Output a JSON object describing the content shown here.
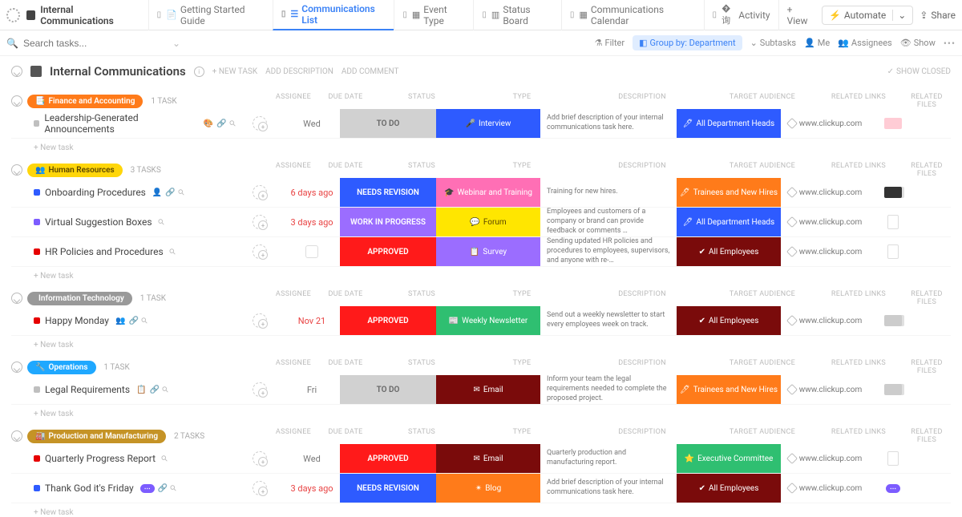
{
  "topbar": {
    "title": "Internal Communications",
    "tabs": [
      {
        "label": "Getting Started Guide",
        "icon": "📄"
      },
      {
        "label": "Communications List",
        "icon": "☰",
        "active": true
      },
      {
        "label": "Event Type",
        "icon": "▦"
      },
      {
        "label": "Status Board",
        "icon": "▥"
      },
      {
        "label": "Communications Calendar",
        "icon": "▦"
      },
      {
        "label": "Activity",
        "icon": "�询"
      }
    ],
    "add_view": "+  View",
    "automate": "Automate",
    "share": "Share"
  },
  "filterbar": {
    "search_placeholder": "Search tasks...",
    "filter": "Filter",
    "group_by": "Group by: Department",
    "subtasks": "Subtasks",
    "me": "Me",
    "assignees": "Assignees",
    "show": "Show"
  },
  "header": {
    "title": "Internal Communications",
    "new_task": "+ NEW TASK",
    "add_desc": "ADD DESCRIPTION",
    "add_comment": "ADD COMMENT",
    "show_closed": "SHOW CLOSED"
  },
  "columns": [
    "ASSIGNEE",
    "DUE DATE",
    "STATUS",
    "TYPE",
    "DESCRIPTION",
    "TARGET AUDIENCE",
    "RELATED LINKS",
    "RELATED FILES"
  ],
  "new_task_label": "+ New task",
  "link_text": "www.clickup.com",
  "groups": [
    {
      "name": "Finance and Accounting",
      "icon": "📑",
      "color": "#ff7b1a",
      "count": "1 TASK",
      "rows": [
        {
          "bullet": "#bfbfbf",
          "name": "Leadership-Generated Announcements",
          "icons": [
            "🎨",
            "🔗"
          ],
          "due": "Wed",
          "overdue": false,
          "status": {
            "label": "TO DO",
            "bg": "#d1d1d1",
            "fg": "#666"
          },
          "type": {
            "label": "Interview",
            "bg": "#2e5bff",
            "icon": "🎤"
          },
          "desc": "Add brief description of your internal communications task here.",
          "audience": {
            "label": "All Department Heads",
            "bg": "#2e5bff",
            "icon": "🖊"
          },
          "file": {
            "bg": "#ffccd5"
          }
        }
      ]
    },
    {
      "name": "Human Resources",
      "icon": "👥",
      "color": "#ffd60a",
      "text_color": "#5a4500",
      "count": "3 TASKS",
      "rows": [
        {
          "bullet": "#2e5bff",
          "name": "Onboarding Procedures",
          "icons": [
            "👤",
            "🔗"
          ],
          "due": "6 days ago",
          "overdue": true,
          "status": {
            "label": "NEEDS REVISION",
            "bg": "#2e5bff"
          },
          "type": {
            "label": "Webinar and Training",
            "bg": "#ff6fb5",
            "icon": "🎓"
          },
          "desc": "Training for new hires.",
          "audience": {
            "label": "Trainees and New Hires",
            "bg": "#ff7b1a",
            "icon": "🖊"
          },
          "file": {
            "bg": "#333",
            "multi": true
          }
        },
        {
          "bullet": "#7c5cff",
          "name": "Virtual Suggestion Boxes",
          "icons": [],
          "due": "3 days ago",
          "overdue": true,
          "status": {
            "label": "WORK IN PROGRESS",
            "bg": "#9b6dff"
          },
          "type": {
            "label": "Forum",
            "bg": "#ffe600",
            "fg": "#5a4500",
            "icon": "💬"
          },
          "desc": "Employees and customers of a company or brand can provide feedback or comments …",
          "audience": {
            "label": "All Department Heads",
            "bg": "#2e5bff",
            "icon": "🖊"
          },
          "file": {
            "bg": "#eee",
            "doc": true
          }
        },
        {
          "bullet": "#e60000",
          "name": "HR Policies and Procedures",
          "icons": [],
          "due": "",
          "overdue": false,
          "due_empty": true,
          "status": {
            "label": "APPROVED",
            "bg": "#ff1a1a"
          },
          "type": {
            "label": "Survey",
            "bg": "#9b6dff",
            "icon": "📋"
          },
          "desc": "Sending updated HR policies and procedures to employees, supervisors, and anyone with re-…",
          "audience": {
            "label": "All Employees",
            "bg": "#7a0b0b",
            "icon": "✔"
          },
          "file": {
            "bg": "#eee",
            "doc": true
          }
        }
      ]
    },
    {
      "name": "Information Technology",
      "icon": "",
      "color": "#999999",
      "count": "1 TASK",
      "rows": [
        {
          "bullet": "#e60000",
          "name": "Happy Monday",
          "icons": [
            "👥",
            "🔗"
          ],
          "due": "Nov 21",
          "overdue": true,
          "status": {
            "label": "APPROVED",
            "bg": "#ff1a1a"
          },
          "type": {
            "label": "Weekly Newsletter",
            "bg": "#2fbf71",
            "icon": "📰"
          },
          "desc": "Send out a weekly newsletter to start every employees week on track.",
          "audience": {
            "label": "All Employees",
            "bg": "#7a0b0b",
            "icon": "✔"
          },
          "file": {
            "bg": "#ccc",
            "multi": true
          }
        }
      ]
    },
    {
      "name": "Operations",
      "icon": "🔧",
      "color": "#1fa8ff",
      "count": "1 TASK",
      "rows": [
        {
          "bullet": "#bfbfbf",
          "name": "Legal Requirements",
          "icons": [
            "📋",
            "🔗"
          ],
          "due": "Fri",
          "overdue": false,
          "status": {
            "label": "TO DO",
            "bg": "#d1d1d1",
            "fg": "#666"
          },
          "type": {
            "label": "Email",
            "bg": "#7a0b0b",
            "icon": "✉"
          },
          "desc": "Inform your team the legal requirements needed to complete the proposed project.",
          "audience": {
            "label": "Trainees and New Hires",
            "bg": "#ff7b1a",
            "icon": "🖊"
          },
          "file": {
            "bg": "#ccc",
            "multi": true
          }
        }
      ]
    },
    {
      "name": "Production and Manufacturing",
      "icon": "🏭",
      "color": "#c59326",
      "count": "2 TASKS",
      "rows": [
        {
          "bullet": "#e60000",
          "name": "Quarterly Progress Report",
          "icons": [],
          "due": "Wed",
          "overdue": false,
          "status": {
            "label": "APPROVED",
            "bg": "#ff1a1a"
          },
          "type": {
            "label": "Email",
            "bg": "#7a0b0b",
            "icon": "✉"
          },
          "desc": "Quarterly production and manufacturing report.",
          "audience": {
            "label": "Executive Committee",
            "bg": "#2fbf71",
            "icon": "⭐"
          },
          "file": {
            "bg": "#eee",
            "doc": true
          }
        },
        {
          "bullet": "#2e5bff",
          "name": "Thank God it's Friday",
          "icons": [
            "chip",
            "🔗"
          ],
          "due": "3 days ago",
          "overdue": true,
          "status": {
            "label": "NEEDS REVISION",
            "bg": "#2e5bff"
          },
          "type": {
            "label": "Blog",
            "bg": "#ff7b1a",
            "icon": "✴"
          },
          "desc": "Add brief description of your internal communications task here.",
          "audience": {
            "label": "All Employees",
            "bg": "#7a0b0b",
            "icon": "✔"
          },
          "file": {
            "bg": "#7c5cff",
            "chip": true
          }
        }
      ]
    }
  ]
}
